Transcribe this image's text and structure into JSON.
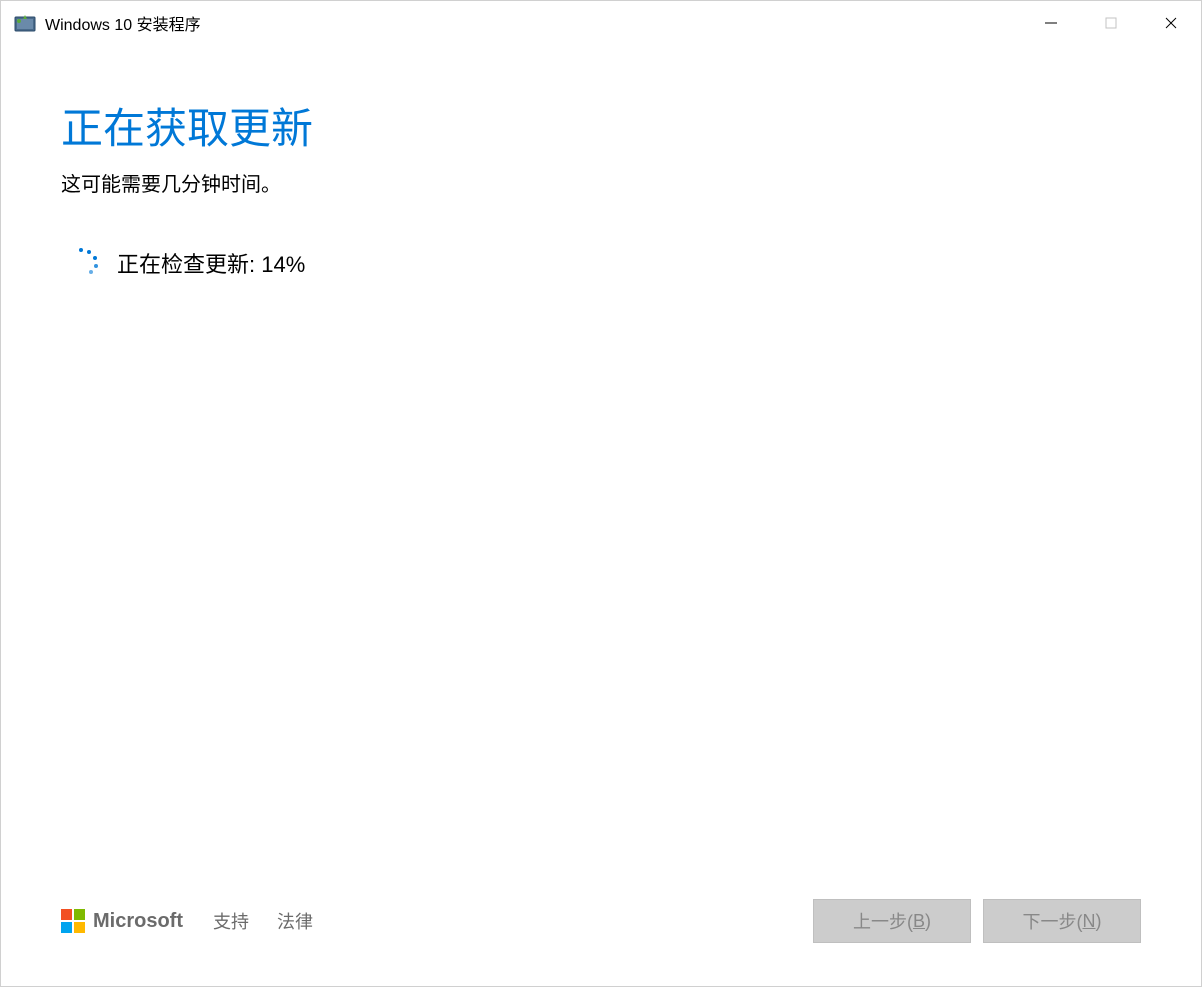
{
  "window": {
    "title": "Windows 10 安装程序"
  },
  "main": {
    "heading": "正在获取更新",
    "subheading": "这可能需要几分钟时间。",
    "progress_text": "正在检查更新: 14%"
  },
  "footer": {
    "brand": "Microsoft",
    "links": {
      "support": "支持",
      "legal": "法律"
    },
    "buttons": {
      "back_prefix": "上一步(",
      "back_key": "B",
      "back_suffix": ")",
      "next_prefix": "下一步(",
      "next_key": "N",
      "next_suffix": ")"
    }
  }
}
